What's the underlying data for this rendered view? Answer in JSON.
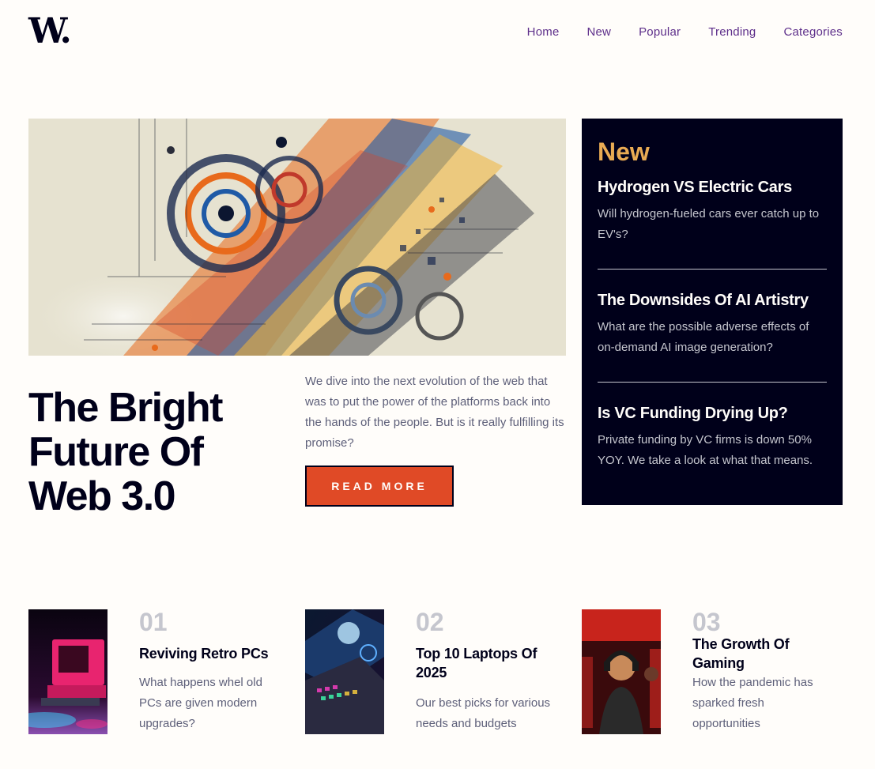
{
  "header": {
    "logo": "W.",
    "nav": [
      "Home",
      "New",
      "Popular",
      "Trending",
      "Categories"
    ]
  },
  "hero": {
    "image_alt": "abstract colorful web art",
    "title": "The Bright Future Of Web 3.0",
    "description": "We dive into the next evolution of the web that was to put the power of the platforms back into the hands of the people. But is it really fulfilling its promise?",
    "button_label": "READ MORE"
  },
  "new_panel": {
    "heading": "New",
    "items": [
      {
        "title": "Hydrogen VS Electric Cars",
        "text": "Will hydrogen-fueled cars ever catch up to EV's?"
      },
      {
        "title": "The Downsides Of AI Artistry",
        "text": "What are the possible adverse effects of on-demand AI image generation?"
      },
      {
        "title": "Is VC Funding Drying Up?",
        "text": "Private funding by VC firms is down 50% YOY. We take a look at what that means."
      }
    ]
  },
  "cards": [
    {
      "num": "01",
      "title": "Reviving Retro PCs",
      "text": "What happens whel old PCs are given modern upgrades?"
    },
    {
      "num": "02",
      "title": "Top 10 Laptops Of 2025",
      "text": "Our best picks for various needs and budgets"
    },
    {
      "num": "03",
      "title": "The Growth Of Gaming",
      "text": "How the pandemic has sparked fresh opportunities"
    }
  ],
  "colors": {
    "accent": "#e04a26",
    "dark": "#00001a",
    "highlight": "#e9ab53",
    "nav": "#5d2e8a",
    "muted": "#5d5f79"
  }
}
